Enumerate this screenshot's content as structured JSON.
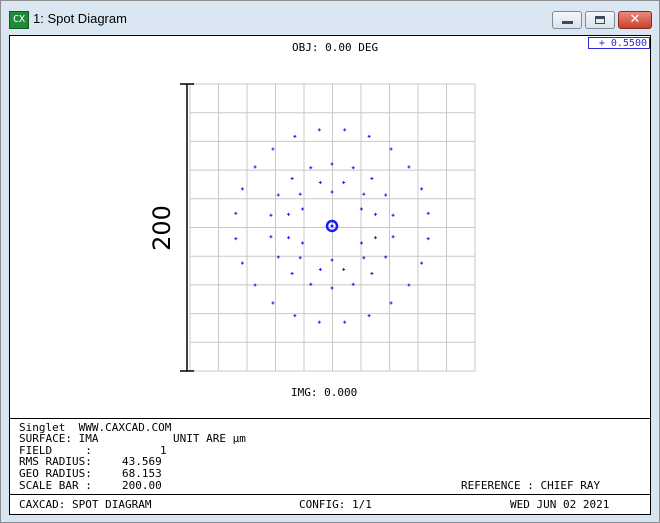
{
  "window": {
    "title": "1: Spot Diagram",
    "app_icon_text": "CX",
    "close_glyph": "✕"
  },
  "plot": {
    "header": "OBJ: 0.00 DEG",
    "footer": "IMG: 0.000",
    "scale_bar_label": "200",
    "wavelength_label": "+ 0.5500",
    "spot_color": "#1a1aff",
    "grid_color": "#c8c8c8"
  },
  "info": {
    "line1_left": "Singlet  WWW.CAXCAD.COM",
    "surface_label": "SURFACE: IMA",
    "unit_label": "UNIT ARE µm",
    "field_label": "FIELD     :",
    "field_value": "1",
    "rms_label": "RMS RADIUS:",
    "rms_value": "43.569",
    "geo_label": "GEO RADIUS:",
    "geo_value": "68.153",
    "scale_label": "SCALE BAR :",
    "scale_value": "200.00",
    "reference": "REFERENCE : CHIEF RAY"
  },
  "statusbar": {
    "left": "CAXCAD: SPOT DIAGRAM",
    "center": "CONFIG: 1/1",
    "right": "WED JUN 02 2021"
  }
}
